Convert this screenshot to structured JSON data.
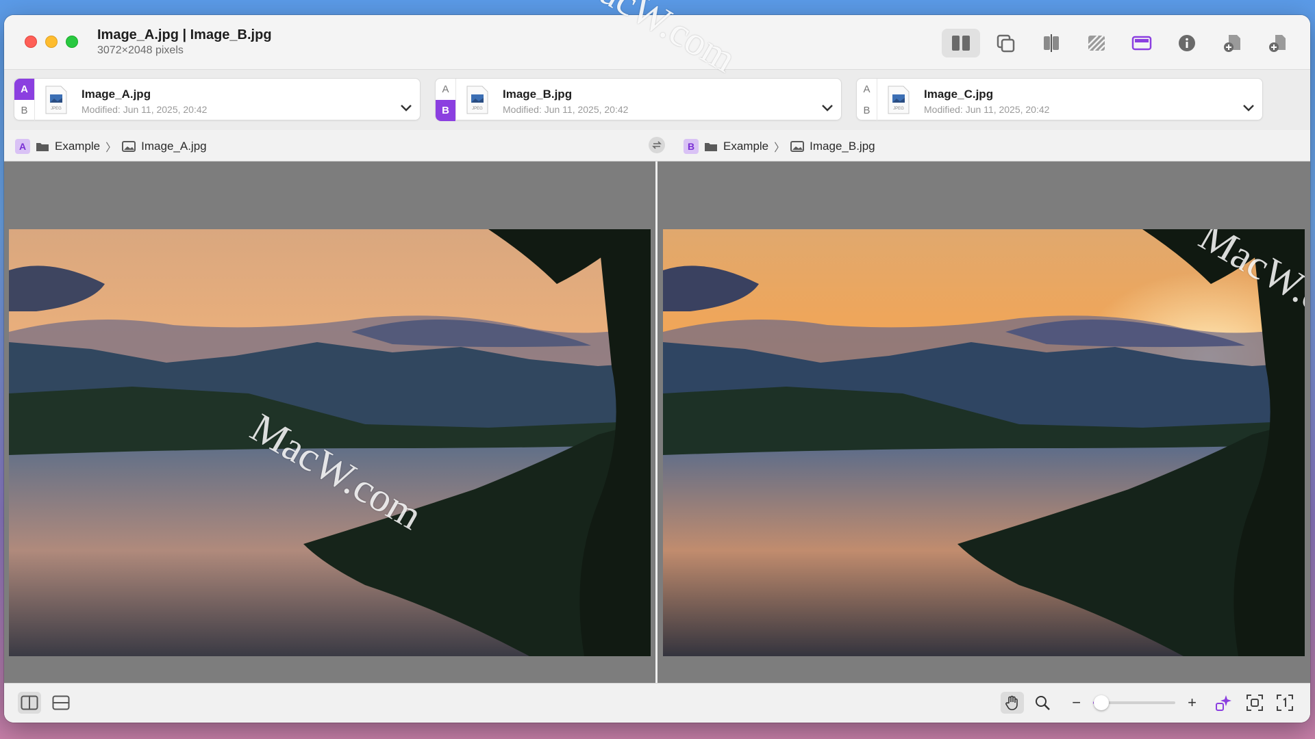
{
  "window": {
    "title": "Image_A.jpg | Image_B.jpg",
    "subtitle": "3072×2048 pixels"
  },
  "toolbar": {
    "icons": [
      "side-by-side-icon",
      "overlay-icon",
      "split-icon",
      "difference-icon",
      "sync-icon",
      "info-icon",
      "add-file-icon",
      "add-file-alt-icon"
    ],
    "accent": "#8b3fe0"
  },
  "files": [
    {
      "a": "A",
      "b": "B",
      "active": "A",
      "name": "Image_A.jpg",
      "modified": "Modified: Jun 11, 2025, 20:42"
    },
    {
      "a": "A",
      "b": "B",
      "active": "B",
      "name": "Image_B.jpg",
      "modified": "Modified: Jun 11, 2025, 20:42"
    },
    {
      "a": "A",
      "b": "B",
      "active": "",
      "name": "Image_C.jpg",
      "modified": "Modified: Jun 11, 2025, 20:42"
    }
  ],
  "path": {
    "left": {
      "tag": "A",
      "folder": "Example",
      "sep": "〉",
      "file": "Image_A.jpg"
    },
    "right": {
      "tag": "B",
      "folder": "Example",
      "sep": "〉",
      "file": "Image_B.jpg"
    }
  },
  "watermark": "MacW.com",
  "bottom": {
    "minus": "−",
    "plus": "+",
    "zoom_fraction": 0.1
  }
}
